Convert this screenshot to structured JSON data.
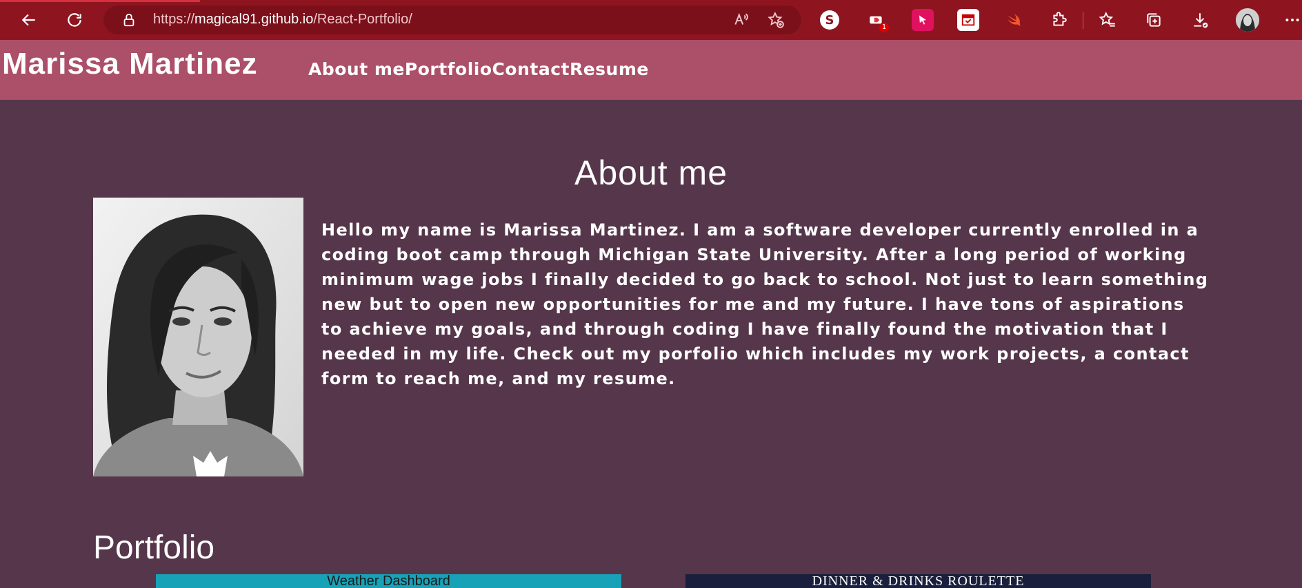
{
  "browser": {
    "url_prefix": "https://",
    "url_host": "magical91.github.io",
    "url_path": "/React-Portfolio/",
    "extension_s_letter": "S",
    "extension_badge_count": "1",
    "icons": [
      "back-icon",
      "refresh-icon",
      "lock-icon",
      "read-aloud-icon",
      "add-favorite-icon",
      "s-extension-icon",
      "red-extension-icon",
      "pink-cursor-extension-icon",
      "calendar-extension-icon",
      "swift-icon",
      "puzzle-extensions-icon",
      "favorites-icon",
      "collections-icon",
      "downloads-icon",
      "profile-avatar",
      "more-icon"
    ],
    "colors": {
      "toolbar": "#8e1520",
      "address": "#7b101b"
    }
  },
  "site": {
    "brand": "Marissa Martinez",
    "nav": [
      "About me",
      "Portfolio",
      "Contact",
      "Resume"
    ],
    "colors": {
      "header": "#ac4f68",
      "background": "#56364a"
    }
  },
  "about": {
    "title": "About me",
    "text": "Hello my name is Marissa Martinez. I am a software developer currently enrolled in a coding boot camp through Michigan State University. After a long period of working minimum wage jobs I finally decided to go back to school. Not just to learn something new but to open new opportunities for me and my future. I have tons of aspirations to achieve my goals, and through coding I have finally found the motivation that I needed in my life. Check out my porfolio which includes my work projects, a contact form to reach me, and my resume."
  },
  "portfolio": {
    "title": "Portfolio",
    "cards": [
      {
        "caption": "Weather Dashboard"
      },
      {
        "caption": "DINNER & DRINKS ROULETTE"
      }
    ]
  }
}
